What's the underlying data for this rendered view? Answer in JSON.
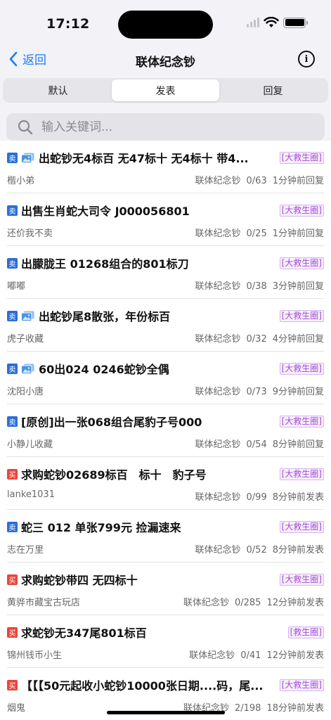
{
  "status": {
    "time": "17:12"
  },
  "nav": {
    "back_label": "返回",
    "title": "联体纪念钞"
  },
  "tabs": [
    {
      "label": "默认"
    },
    {
      "label": "发表"
    },
    {
      "label": "回复"
    }
  ],
  "search": {
    "placeholder": "输入关键词..."
  },
  "posts": [
    {
      "type": "卖",
      "has_image": true,
      "title": "出蛇钞无4标百 无47标十 无4标十 带4...",
      "group": "[大救生圈]",
      "author": "楷小弟",
      "category": "联体纪念钞",
      "stats": "0/63",
      "time": "1分钟前回复"
    },
    {
      "type": "卖",
      "has_image": false,
      "title": "出售生肖蛇大司令 J000056801",
      "group": "[大救生圈]",
      "author": "还价我不卖",
      "category": "联体纪念钞",
      "stats": "0/25",
      "time": "1分钟前回复"
    },
    {
      "type": "卖",
      "has_image": false,
      "title": "出朦胧王 01268组合的801标刀",
      "group": "[大救生圈]",
      "author": "嘟嘟",
      "category": "联体纪念钞",
      "stats": "0/38",
      "time": "3分钟前回复"
    },
    {
      "type": "卖",
      "has_image": true,
      "title": "出蛇钞尾8散张，年份标百",
      "group": "[大救生圈]",
      "author": "虎子收藏",
      "category": "联体纪念钞",
      "stats": "0/32",
      "time": "4分钟前回复"
    },
    {
      "type": "卖",
      "has_image": true,
      "title": "60出024 0246蛇钞全偶",
      "group": "[大救生圈]",
      "author": "沈阳小唐",
      "category": "联体纪念钞",
      "stats": "0/73",
      "time": "9分钟前回复"
    },
    {
      "type": "卖",
      "has_image": false,
      "title": "[原创]出一张068组合尾豹子号000",
      "group": "[大救生圈]",
      "author": "小静儿收藏",
      "category": "联体纪念钞",
      "stats": "0/54",
      "time": "8分钟前回复"
    },
    {
      "type": "买",
      "has_image": false,
      "title": "求购蛇钞02689标百　标十　豹子号",
      "group": "[大救生圈]",
      "author": "lanke1031",
      "category": "联体纪念钞",
      "stats": "0/99",
      "time": "8分钟前发表"
    },
    {
      "type": "卖",
      "has_image": false,
      "title": "蛇三 012 单张799元 捡漏速来",
      "group": "[大救生圈]",
      "author": "志在万里",
      "category": "联体纪念钞",
      "stats": "0/52",
      "time": "8分钟前发表"
    },
    {
      "type": "买",
      "has_image": false,
      "title": "求购蛇钞带四 无四标十",
      "group": "[大救生圈]",
      "author": "黄骅市藏宝古玩店",
      "category": "联体纪念钞",
      "stats": "0/285",
      "time": "12分钟前发表"
    },
    {
      "type": "买",
      "has_image": false,
      "title": "求蛇钞无347尾801标百",
      "group": "[救生圈]",
      "author": "锦州钱币小生",
      "category": "联体纪念钞",
      "stats": "0/41",
      "time": "12分钟前发表"
    },
    {
      "type": "买",
      "has_image": false,
      "title": "【【【50元起收小蛇钞10000张日期....码，尾...",
      "group": "[大救生圈]",
      "author": "烟鬼",
      "category": "联体纪念钞",
      "stats": "2/198",
      "time": "18分钟前发表"
    }
  ],
  "colors": {
    "accent": "#1c7cf5",
    "sell_tag": "#2a6fd6",
    "buy_tag": "#e8453c",
    "group_badge": "#a24bd6"
  }
}
